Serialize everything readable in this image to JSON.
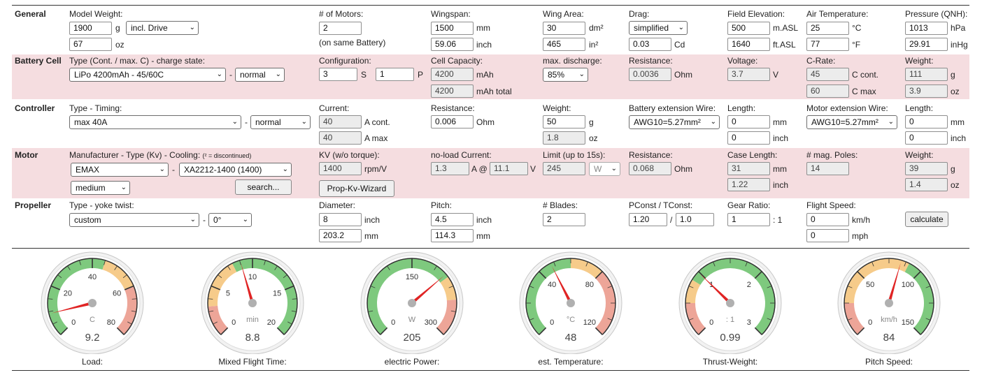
{
  "sections": {
    "general": "General",
    "battery": "Battery Cell",
    "controller": "Controller",
    "motor": "Motor",
    "propeller": "Propeller"
  },
  "general": {
    "model_weight_label": "Model Weight:",
    "model_weight_g": "1900",
    "unit_g": "g",
    "drive_select": "incl. Drive",
    "model_weight_oz": "67",
    "unit_oz": "oz",
    "motors_label": "# of Motors:",
    "motors_value": "2",
    "motors_note": "(on same Battery)",
    "wingspan_label": "Wingspan:",
    "wingspan_mm": "1500",
    "unit_mm": "mm",
    "wingspan_inch": "59.06",
    "unit_inch": "inch",
    "wingarea_label": "Wing Area:",
    "wingarea_dm2": "30",
    "unit_dm2": "dm²",
    "wingarea_in2": "465",
    "unit_in2": "in²",
    "drag_label": "Drag:",
    "drag_select": "simplified",
    "drag_cd": "0.03",
    "unit_cd": "Cd",
    "elev_label": "Field Elevation:",
    "elev_m": "500",
    "unit_masl": "m.ASL",
    "elev_ft": "1640",
    "unit_ftasl": "ft.ASL",
    "temp_label": "Air Temperature:",
    "temp_c": "25",
    "unit_c": "°C",
    "temp_f": "77",
    "unit_f": "°F",
    "press_label": "Pressure (QNH):",
    "press_hpa": "1013",
    "unit_hpa": "hPa",
    "press_inhg": "29.91",
    "unit_inhg": "inHg"
  },
  "battery": {
    "type_label": "Type (Cont. / max. C) - charge state:",
    "type_select": "LiPo 4200mAh - 45/60C",
    "dash": "-",
    "state_select": "normal",
    "config_label": "Configuration:",
    "config_s": "3",
    "unit_s": "S",
    "config_p": "1",
    "unit_p": "P",
    "capacity_label": "Cell Capacity:",
    "capacity": "4200",
    "unit_mah": "mAh",
    "capacity_total": "4200",
    "unit_mah_total": "mAh total",
    "discharge_label": "max. discharge:",
    "discharge_select": "85%",
    "res_label": "Resistance:",
    "res_value": "0.0036",
    "unit_ohm": "Ohm",
    "volt_label": "Voltage:",
    "volt_value": "3.7",
    "unit_v": "V",
    "crate_label": "C-Rate:",
    "crate_cont": "45",
    "unit_ccont": "C cont.",
    "crate_max": "60",
    "unit_cmax": "C max",
    "weight_label": "Weight:",
    "weight_g": "111",
    "unit_g": "g",
    "weight_oz": "3.9",
    "unit_oz": "oz"
  },
  "controller": {
    "type_label": "Type - Timing:",
    "type_select": "max 40A",
    "dash": "-",
    "timing_select": "normal",
    "current_label": "Current:",
    "current_cont": "40",
    "unit_acont": "A cont.",
    "current_max": "40",
    "unit_amax": "A max",
    "res_label": "Resistance:",
    "res_value": "0.006",
    "unit_ohm": "Ohm",
    "weight_label": "Weight:",
    "weight_g": "50",
    "unit_g": "g",
    "weight_oz": "1.8",
    "unit_oz": "oz",
    "bwire_label": "Battery extension Wire:",
    "bwire_select": "AWG10=5.27mm²",
    "blen_label": "Length:",
    "blen_mm": "0",
    "unit_mm": "mm",
    "blen_inch": "0",
    "unit_inch": "inch",
    "mwire_label": "Motor extension Wire:",
    "mwire_select": "AWG10=5.27mm²",
    "mlen_label": "Length:",
    "mlen_mm": "0",
    "mlen_inch": "0"
  },
  "motor": {
    "type_label": "Manufacturer - Type (Kv) - Cooling:",
    "discontinued_note": "(² = discontinued)",
    "manufacturer_select": "EMAX",
    "dash": "-",
    "model_select": "XA2212-1400 (1400)",
    "cooling_select": "medium",
    "search_button": "search...",
    "kv_label": "KV (w/o torque):",
    "kv_value": "1400",
    "unit_rpmv": "rpm/V",
    "wizard_button": "Prop-Kv-Wizard",
    "noload_label": "no-load Current:",
    "noload_a": "1.3",
    "unit_a_at": "A @",
    "noload_v": "11.1",
    "unit_v": "V",
    "limit_label": "Limit (up to 15s):",
    "limit_value": "245",
    "limit_unit_select": "W",
    "res_label": "Resistance:",
    "res_value": "0.068",
    "unit_ohm": "Ohm",
    "case_label": "Case Length:",
    "case_mm": "31",
    "unit_mm": "mm",
    "case_inch": "1.22",
    "unit_inch": "inch",
    "poles_label": "# mag. Poles:",
    "poles_value": "14",
    "weight_label": "Weight:",
    "weight_g": "39",
    "unit_g": "g",
    "weight_oz": "1.4",
    "unit_oz": "oz"
  },
  "propeller": {
    "type_label": "Type - yoke twist:",
    "type_select": "custom",
    "dash": "-",
    "twist_select": "0°",
    "diam_label": "Diameter:",
    "diam_inch": "8",
    "unit_inch": "inch",
    "diam_mm": "203.2",
    "unit_mm": "mm",
    "pitch_label": "Pitch:",
    "pitch_inch": "4.5",
    "pitch_mm": "114.3",
    "blades_label": "# Blades:",
    "blades_value": "2",
    "pconst_label": "PConst / TConst:",
    "pconst": "1.20",
    "slash": "/",
    "tconst": "1.0",
    "gear_label": "Gear Ratio:",
    "gear_value": "1",
    "gear_suffix": ": 1",
    "speed_label": "Flight Speed:",
    "speed_kmh": "0",
    "unit_kmh": "km/h",
    "speed_mph": "0",
    "unit_mph": "mph",
    "calc_button": "calculate"
  },
  "gauges": [
    {
      "name": "Load:",
      "unit": "C",
      "value": "9.2",
      "reading": 9.2,
      "min": 0,
      "max": 80,
      "ticks": [
        "0",
        "20",
        "40",
        "60",
        "80"
      ],
      "zones": [
        {
          "from": 0,
          "to": 45,
          "color": "#7ec97e"
        },
        {
          "from": 45,
          "to": 60,
          "color": "#f6cb8a"
        },
        {
          "from": 60,
          "to": 80,
          "color": "#eda598"
        }
      ]
    },
    {
      "name": "Mixed Flight Time:",
      "unit": "min",
      "value": "8.8",
      "reading": 8.8,
      "min": 0,
      "max": 20,
      "ticks": [
        "0",
        "5",
        "10",
        "15",
        "20"
      ],
      "zones": [
        {
          "from": 0,
          "to": 3,
          "color": "#eda598"
        },
        {
          "from": 3,
          "to": 8,
          "color": "#f6cb8a"
        },
        {
          "from": 8,
          "to": 20,
          "color": "#7ec97e"
        }
      ]
    },
    {
      "name": "electric Power:",
      "unit": "W",
      "value": "205",
      "reading": 205,
      "min": 0,
      "max": 300,
      "ticks": [
        "0",
        "150",
        "300"
      ],
      "zones": [
        {
          "from": 0,
          "to": 210,
          "color": "#7ec97e"
        },
        {
          "from": 210,
          "to": 245,
          "color": "#f6cb8a"
        },
        {
          "from": 245,
          "to": 300,
          "color": "#eda598"
        }
      ]
    },
    {
      "name": "est. Temperature:",
      "unit": "°C",
      "value": "48",
      "reading": 48,
      "min": 0,
      "max": 120,
      "ticks": [
        "0",
        "40",
        "80",
        "120"
      ],
      "zones": [
        {
          "from": 0,
          "to": 60,
          "color": "#7ec97e"
        },
        {
          "from": 60,
          "to": 80,
          "color": "#f6cb8a"
        },
        {
          "from": 80,
          "to": 120,
          "color": "#eda598"
        }
      ]
    },
    {
      "name": "Thrust-Weight:",
      "unit": ": 1",
      "value": "0.99",
      "reading": 0.99,
      "min": 0,
      "max": 3,
      "ticks": [
        "0",
        "1",
        "2",
        "3"
      ],
      "zones": [
        {
          "from": 0,
          "to": 0.5,
          "color": "#eda598"
        },
        {
          "from": 0.5,
          "to": 0.85,
          "color": "#f6cb8a"
        },
        {
          "from": 0.85,
          "to": 3,
          "color": "#7ec97e"
        }
      ]
    },
    {
      "name": "Pitch Speed:",
      "unit": "km/h",
      "value": "84",
      "reading": 84,
      "min": 0,
      "max": 150,
      "ticks": [
        "0",
        "50",
        "100",
        "150"
      ],
      "zones": [
        {
          "from": 0,
          "to": 25,
          "color": "#eda598"
        },
        {
          "from": 25,
          "to": 90,
          "color": "#f6cb8a"
        },
        {
          "from": 90,
          "to": 150,
          "color": "#7ec97e"
        }
      ]
    }
  ]
}
